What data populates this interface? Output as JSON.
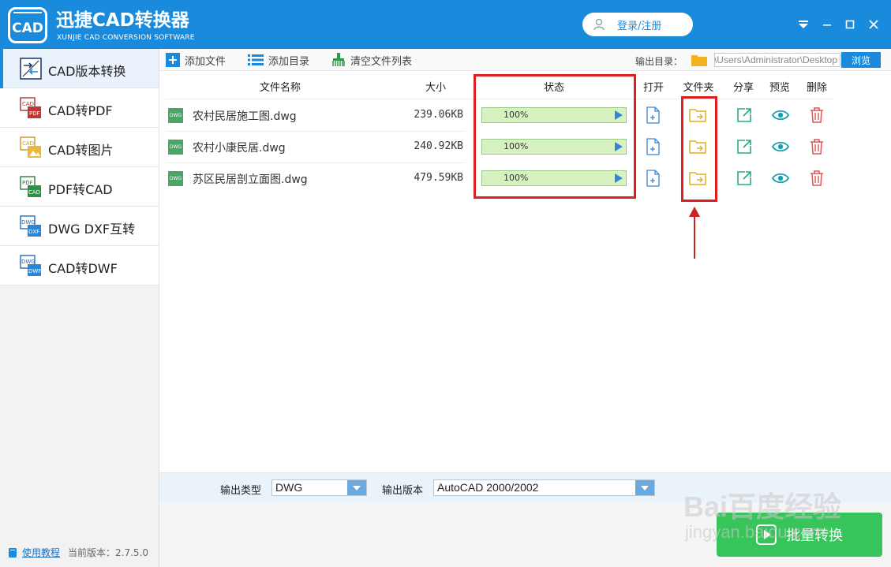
{
  "app": {
    "title": "迅捷CAD转换器",
    "subtitle": "XUNJIE CAD CONVERSION SOFTWARE",
    "logo_text": "CAD",
    "login_label": "登录/注册",
    "brand_color": "#1a8bdc"
  },
  "sidebar": {
    "items": [
      {
        "label": "CAD版本转换",
        "icon": "cad-version-icon",
        "active": true
      },
      {
        "label": "CAD转PDF",
        "icon": "cad-to-pdf-icon",
        "active": false
      },
      {
        "label": "CAD转图片",
        "icon": "cad-to-image-icon",
        "active": false
      },
      {
        "label": "PDF转CAD",
        "icon": "pdf-to-cad-icon",
        "active": false
      },
      {
        "label": "DWG DXF互转",
        "icon": "dwg-dxf-icon",
        "active": false
      },
      {
        "label": "CAD转DWF",
        "icon": "cad-to-dwf-icon",
        "active": false
      }
    ],
    "tutorial_label": "使用教程",
    "version_label": "当前版本：",
    "version_value": "2.7.5.0"
  },
  "toolbar": {
    "add_file": "添加文件",
    "add_folder": "添加目录",
    "clear_list": "清空文件列表",
    "output_label": "输出目录：",
    "output_path": "C:\\Users\\Administrator\\Desktop",
    "browse_label": "浏览"
  },
  "table": {
    "headers": {
      "name": "文件名称",
      "size": "大小",
      "status": "状态",
      "open": "打开",
      "folder": "文件夹",
      "share": "分享",
      "preview": "预览",
      "delete": "删除"
    },
    "badge_text": "DWG",
    "rows": [
      {
        "name": "农村民居施工图.dwg",
        "size": "239.06KB",
        "progress": 100,
        "progress_text": "100%"
      },
      {
        "name": "农村小康民居.dwg",
        "size": "240.92KB",
        "progress": 100,
        "progress_text": "100%"
      },
      {
        "name": "苏区民居剖立面图.dwg",
        "size": "479.59KB",
        "progress": 100,
        "progress_text": "100%"
      }
    ]
  },
  "options": {
    "output_type_label": "输出类型",
    "output_type_value": "DWG",
    "output_version_label": "输出版本",
    "output_version_value": "AutoCAD 2000/2002"
  },
  "batch_button": "批量转换",
  "watermark": {
    "main": "Bai百度经验",
    "sub": "jingyan.baidu.com"
  }
}
